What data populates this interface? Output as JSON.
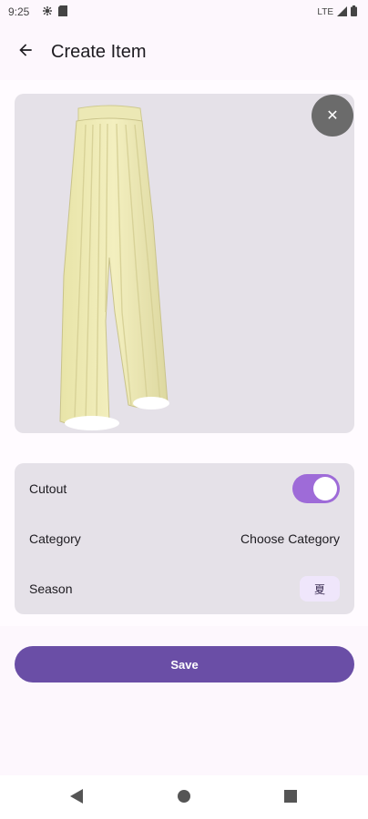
{
  "status": {
    "time": "9:25",
    "network": "LTE"
  },
  "appbar": {
    "title": "Create Item"
  },
  "image": {
    "subject": "pants-photo"
  },
  "settings": {
    "cutout_label": "Cutout",
    "cutout_on": true,
    "category_label": "Category",
    "category_value": "Choose Category",
    "season_label": "Season",
    "season_value": "夏"
  },
  "actions": {
    "save_label": "Save"
  },
  "colors": {
    "accent": "#6a4ea6",
    "toggle": "#9e6bd8",
    "card": "#e5e1e8"
  }
}
